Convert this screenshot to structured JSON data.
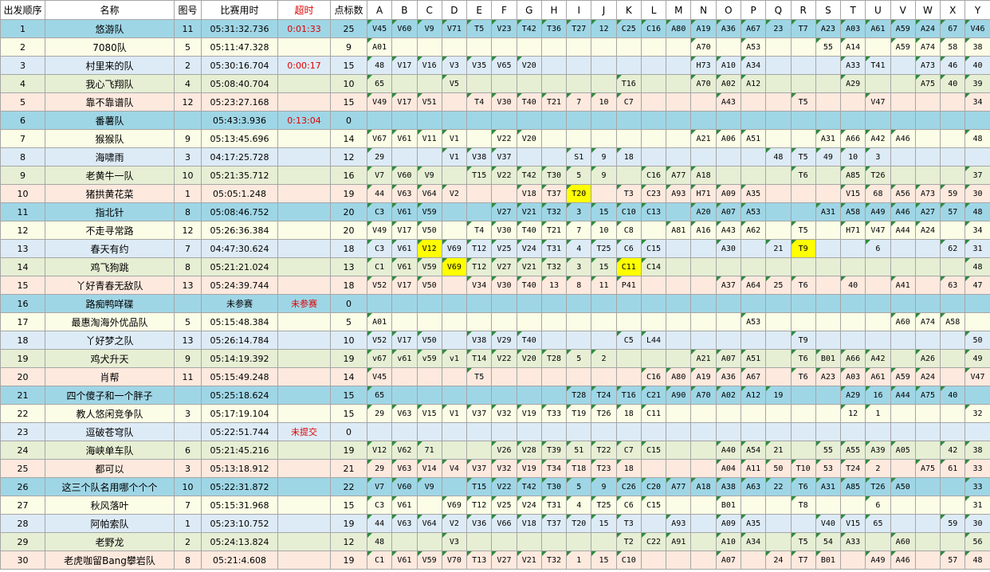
{
  "headers": {
    "order": "出发顺序",
    "name": "名称",
    "map": "图号",
    "time": "比赛用时",
    "overtime": "超时",
    "points": "点标数",
    "cols": [
      "A",
      "B",
      "C",
      "D",
      "E",
      "F",
      "G",
      "H",
      "I",
      "J",
      "K",
      "L",
      "M",
      "N",
      "O",
      "P",
      "Q",
      "R",
      "S",
      "T",
      "U",
      "V",
      "W",
      "X",
      "Y"
    ]
  },
  "palette": [
    "#9fd6e6",
    "#fbfde6",
    "#ddebf6",
    "#e6efd4",
    "#fde9de"
  ],
  "markers": {
    "triangle_color": "#2e8b3e",
    "highlight_color": "#ffff00",
    "overtime_color": "#e00000"
  },
  "rows": [
    {
      "order": "1",
      "name": "悠游队",
      "map": "11",
      "time": "05:31:32.736",
      "overtime": "0:01:33",
      "points": "25",
      "cells": [
        "V45",
        "V60",
        "V9",
        "V71",
        "T5",
        "V23",
        "T42",
        "T36",
        "T27",
        "12",
        "C25",
        "C16",
        "A80",
        "A19",
        "A36",
        "A67",
        "23",
        "T7",
        "A23",
        "A03",
        "A61",
        "A59",
        "A24",
        "67",
        "V46"
      ]
    },
    {
      "order": "2",
      "name": "7080队",
      "map": "5",
      "time": "05:11:47.328",
      "overtime": "",
      "points": "9",
      "cells": [
        "A01",
        "",
        "",
        "",
        "",
        "",
        "",
        "",
        "",
        "",
        "",
        "",
        "",
        "A70",
        "",
        "A53",
        "",
        "",
        "55",
        "A14",
        "",
        "A59",
        "A74",
        "58",
        "38"
      ]
    },
    {
      "order": "3",
      "name": "村里来的队",
      "map": "2",
      "time": "05:30:16.704",
      "overtime": "0:00:17",
      "points": "15",
      "cells": [
        "48",
        "V17",
        "V16",
        "V3",
        "V35",
        "V65",
        "V20",
        "",
        "",
        "",
        "",
        "",
        "",
        "H73",
        "A10",
        "A34",
        "",
        "",
        "",
        "A33",
        "T41",
        "",
        "A73",
        "46",
        "40"
      ]
    },
    {
      "order": "4",
      "name": "我心飞翔队",
      "map": "4",
      "time": "05:08:40.704",
      "overtime": "",
      "points": "10",
      "cells": [
        "65",
        "",
        "",
        "V5",
        "",
        "",
        "",
        "",
        "",
        "",
        "T16",
        "",
        "",
        "A70",
        "A02",
        "A12",
        "",
        "",
        "",
        "A29",
        "",
        "",
        "A75",
        "40",
        "39"
      ]
    },
    {
      "order": "5",
      "name": "靠不靠谱队",
      "map": "12",
      "time": "05:23:27.168",
      "overtime": "",
      "points": "15",
      "cells": [
        "V49",
        "V17",
        "V51",
        "",
        "T4",
        "V30",
        "T40",
        "T21",
        "7",
        "10",
        "C7",
        "",
        "",
        "",
        "A43",
        "",
        "",
        "T5",
        "",
        "",
        "V47",
        "",
        "",
        "",
        "34"
      ]
    },
    {
      "order": "6",
      "name": "番薯队",
      "map": "",
      "time": "05:43:3.936",
      "overtime": "0:13:04",
      "points": "0",
      "cells": [
        "",
        "",
        "",
        "",
        "",
        "",
        "",
        "",
        "",
        "",
        "",
        "",
        "",
        "",
        "",
        "",
        "",
        "",
        "",
        "",
        "",
        "",
        "",
        "",
        ""
      ]
    },
    {
      "order": "7",
      "name": "猴猴队",
      "map": "9",
      "time": "05:13:45.696",
      "overtime": "",
      "points": "14",
      "cells": [
        "V67",
        "V61",
        "V11",
        "V1",
        "",
        "V22",
        "V20",
        "",
        "",
        "",
        "",
        "",
        "",
        "A21",
        "A06",
        "A51",
        "",
        "",
        "A31",
        "A66",
        "A42",
        "A46",
        "",
        "",
        "48"
      ]
    },
    {
      "order": "8",
      "name": "海啸雨",
      "map": "3",
      "time": "04:17:25.728",
      "overtime": "",
      "points": "12",
      "cells": [
        "29",
        "",
        "",
        "V1",
        "V38",
        "V37",
        "",
        "",
        "S1",
        "9",
        "18",
        "",
        "",
        "",
        "",
        "",
        "48",
        "T5",
        "49",
        "10",
        "3",
        "",
        "",
        "",
        ""
      ]
    },
    {
      "order": "9",
      "name": "老黄牛一队",
      "map": "10",
      "time": "05:21:35.712",
      "overtime": "",
      "points": "16",
      "cells": [
        "V7",
        "V60",
        "V9",
        "",
        "T15",
        "V22",
        "T42",
        "T30",
        "5",
        "9",
        "",
        "C16",
        "A77",
        "A18",
        "",
        "",
        "",
        "T6",
        "",
        "A85",
        "T26",
        "",
        "",
        "",
        "37"
      ]
    },
    {
      "order": "10",
      "name": "猪拱黄花菜",
      "map": "1",
      "time": "05:05:1.248",
      "overtime": "",
      "points": "19",
      "cells": [
        "44",
        "V63",
        "V64",
        "V2",
        "",
        "",
        "V18",
        "T37",
        "T20",
        "",
        "T3",
        "C23",
        "A93",
        "H71",
        "A09",
        "A35",
        "",
        "",
        "",
        "V15",
        "68",
        "A56",
        "A73",
        "59",
        "30"
      ]
    },
    {
      "order": "11",
      "name": "指北针",
      "map": "8",
      "time": "05:08:46.752",
      "overtime": "",
      "points": "20",
      "cells": [
        "C3",
        "V61",
        "V59",
        "",
        "",
        "V27",
        "V21",
        "T32",
        "3",
        "15",
        "C10",
        "C13",
        "",
        "A20",
        "A07",
        "A53",
        "",
        "",
        "A31",
        "A58",
        "A49",
        "A46",
        "A27",
        "57",
        "48"
      ]
    },
    {
      "order": "12",
      "name": "不走寻常路",
      "map": "12",
      "time": "05:26:36.384",
      "overtime": "",
      "points": "20",
      "cells": [
        "V49",
        "V17",
        "V50",
        "",
        "T4",
        "V30",
        "T40",
        "T21",
        "7",
        "10",
        "C8",
        "",
        "A81",
        "A16",
        "A43",
        "A62",
        "",
        "T5",
        "",
        "H71",
        "V47",
        "A44",
        "A24",
        "",
        "34"
      ]
    },
    {
      "order": "13",
      "name": "春天有约",
      "map": "7",
      "time": "04:47:30.624",
      "overtime": "",
      "points": "18",
      "cells": [
        "C3",
        "V61",
        "V12",
        "V69",
        "T12",
        "V25",
        "V24",
        "T31",
        "4",
        "T25",
        "C6",
        "C15",
        "",
        "",
        "A30",
        "",
        "21",
        "T9",
        "",
        "",
        "6",
        "",
        "",
        "62",
        "31"
      ]
    },
    {
      "order": "14",
      "name": "鸡飞狗跳",
      "map": "8",
      "time": "05:21:21.024",
      "overtime": "",
      "points": "13",
      "cells": [
        "C1",
        "V61",
        "V59",
        "V69",
        "T12",
        "V27",
        "V21",
        "T32",
        "3",
        "15",
        "C11",
        "C14",
        "",
        "",
        "",
        "",
        "",
        "",
        "",
        "",
        "",
        "",
        "",
        "",
        "48"
      ]
    },
    {
      "order": "15",
      "name": "丫好青春无敌队",
      "map": "13",
      "time": "05:24:39.744",
      "overtime": "",
      "points": "18",
      "cells": [
        "V52",
        "V17",
        "V50",
        "",
        "V34",
        "V30",
        "T40",
        "13",
        "8",
        "11",
        "P41",
        "",
        "",
        "",
        "A37",
        "A64",
        "25",
        "T6",
        "",
        "40",
        "",
        "A41",
        "",
        "63",
        "47"
      ]
    },
    {
      "order": "16",
      "name": "路痴鸭咩碟",
      "map": "",
      "time": "未参赛",
      "overtime": "未参赛",
      "points": "0",
      "cells": [
        "",
        "",
        "",
        "",
        "",
        "",
        "",
        "",
        "",
        "",
        "",
        "",
        "",
        "",
        "",
        "",
        "",
        "",
        "",
        "",
        "",
        "",
        "",
        "",
        ""
      ]
    },
    {
      "order": "17",
      "name": "最惠淘海外优品队",
      "map": "5",
      "time": "05:15:48.384",
      "overtime": "",
      "points": "5",
      "cells": [
        "A01",
        "",
        "",
        "",
        "",
        "",
        "",
        "",
        "",
        "",
        "",
        "",
        "",
        "",
        "",
        "A53",
        "",
        "",
        "",
        "",
        "",
        "A60",
        "A74",
        "A58",
        ""
      ]
    },
    {
      "order": "18",
      "name": "丫好梦之队",
      "map": "13",
      "time": "05:26:14.784",
      "overtime": "",
      "points": "10",
      "cells": [
        "V52",
        "V17",
        "V50",
        "",
        "V38",
        "V29",
        "T40",
        "",
        "",
        "",
        "C5",
        "L44",
        "",
        "",
        "",
        "",
        "",
        "T9",
        "",
        "",
        "",
        "",
        "",
        "",
        "50"
      ]
    },
    {
      "order": "19",
      "name": "鸡犬升天",
      "map": "9",
      "time": "05:14:19.392",
      "overtime": "",
      "points": "19",
      "cells": [
        "v67",
        "v61",
        "v59",
        "v1",
        "T14",
        "V22",
        "V20",
        "T28",
        "5",
        "2",
        "",
        "",
        "",
        "A21",
        "A07",
        "A51",
        "",
        "T6",
        "B01",
        "A66",
        "A42",
        "",
        "A26",
        "",
        "49"
      ]
    },
    {
      "order": "20",
      "name": "肖帮",
      "map": "11",
      "time": "05:15:49.248",
      "overtime": "",
      "points": "14",
      "cells": [
        "V45",
        "",
        "",
        "",
        "T5",
        "",
        "",
        "",
        "",
        "",
        "",
        "C16",
        "A80",
        "A19",
        "A36",
        "A67",
        "",
        "T6",
        "A23",
        "A03",
        "A61",
        "A59",
        "A24",
        "",
        "V47"
      ]
    },
    {
      "order": "21",
      "name": "四个傻子和一个胖子",
      "map": "",
      "time": "05:25:18.624",
      "overtime": "",
      "points": "15",
      "cells": [
        "65",
        "",
        "",
        "",
        "",
        "",
        "",
        "",
        "T28",
        "T24",
        "T16",
        "C21",
        "A90",
        "A70",
        "A02",
        "A12",
        "19",
        "",
        "",
        "A29",
        "16",
        "A44",
        "A75",
        "40",
        ""
      ]
    },
    {
      "order": "22",
      "name": "教人悠闲竞争队",
      "map": "3",
      "time": "05:17:19.104",
      "overtime": "",
      "points": "15",
      "cells": [
        "29",
        "V63",
        "V15",
        "V1",
        "V37",
        "V32",
        "V19",
        "T33",
        "T19",
        "T26",
        "18",
        "C11",
        "",
        "",
        "",
        "",
        "",
        "",
        "",
        "12",
        "1",
        "",
        "",
        "",
        "32"
      ]
    },
    {
      "order": "23",
      "name": "逗破苍穹队",
      "map": "",
      "time": "05:22:51.744",
      "overtime": "未提交",
      "points": "0",
      "cells": [
        "",
        "",
        "",
        "",
        "",
        "",
        "",
        "",
        "",
        "",
        "",
        "",
        "",
        "",
        "",
        "",
        "",
        "",
        "",
        "",
        "",
        "",
        "",
        "",
        ""
      ]
    },
    {
      "order": "24",
      "name": "海峡单车队",
      "map": "6",
      "time": "05:21:45.216",
      "overtime": "",
      "points": "19",
      "cells": [
        "V12",
        "V62",
        "71",
        "",
        "",
        "V26",
        "V28",
        "T39",
        "51",
        "T22",
        "C7",
        "C15",
        "",
        "",
        "A40",
        "A54",
        "21",
        "",
        "55",
        "A55",
        "A39",
        "A05",
        "",
        "42",
        "38"
      ]
    },
    {
      "order": "25",
      "name": "都可以",
      "map": "3",
      "time": "05:13:18.912",
      "overtime": "",
      "points": "21",
      "cells": [
        "29",
        "V63",
        "V14",
        "V4",
        "V37",
        "V32",
        "V19",
        "T34",
        "T18",
        "T23",
        "18",
        "",
        "",
        "",
        "A04",
        "A11",
        "50",
        "T10",
        "53",
        "T24",
        "2",
        "",
        "A75",
        "61",
        "33"
      ]
    },
    {
      "order": "26",
      "name": "这三个队名用哪个个个",
      "map": "10",
      "time": "05:22:31.872",
      "overtime": "",
      "points": "22",
      "cells": [
        "V7",
        "V60",
        "V9",
        "",
        "T15",
        "V22",
        "T42",
        "T30",
        "5",
        "9",
        "C26",
        "C20",
        "A77",
        "A18",
        "A38",
        "A63",
        "22",
        "T6",
        "A31",
        "A85",
        "T26",
        "A50",
        "",
        "",
        "33"
      ]
    },
    {
      "order": "27",
      "name": "秋风落叶",
      "map": "7",
      "time": "05:15:31.968",
      "overtime": "",
      "points": "15",
      "cells": [
        "C3",
        "V61",
        "",
        "V69",
        "T12",
        "V25",
        "V24",
        "T31",
        "4",
        "T25",
        "C6",
        "C15",
        "",
        "",
        "B01",
        "",
        "",
        "T8",
        "",
        "",
        "6",
        "",
        "",
        "",
        "31"
      ]
    },
    {
      "order": "28",
      "name": "阿帕索队",
      "map": "1",
      "time": "05:23:10.752",
      "overtime": "",
      "points": "19",
      "cells": [
        "44",
        "V63",
        "V64",
        "V2",
        "V36",
        "V66",
        "V18",
        "T37",
        "T20",
        "15",
        "T3",
        "",
        "A93",
        "",
        "A09",
        "A35",
        "",
        "",
        "V40",
        "V15",
        "65",
        "",
        "",
        "59",
        "30"
      ]
    },
    {
      "order": "29",
      "name": "老野龙",
      "map": "2",
      "time": "05:24:13.824",
      "overtime": "",
      "points": "12",
      "cells": [
        "48",
        "",
        "",
        "V3",
        "",
        "",
        "",
        "",
        "",
        "",
        "T2",
        "C22",
        "A91",
        "",
        "A10",
        "A34",
        "",
        "T5",
        "54",
        "A33",
        "",
        "A60",
        "",
        "",
        "56"
      ]
    },
    {
      "order": "30",
      "name": "老虎咖留Bang攀岩队",
      "map": "8",
      "time": "05:21:4.608",
      "overtime": "",
      "points": "19",
      "cells": [
        "C1",
        "V61",
        "V59",
        "V70",
        "T13",
        "V27",
        "V21",
        "T32",
        "1",
        "15",
        "C10",
        "",
        "",
        "",
        "A07",
        "",
        "24",
        "T7",
        "B01",
        "",
        "A49",
        "A46",
        "",
        "57",
        "48"
      ]
    }
  ],
  "highlights": [
    {
      "row": 10,
      "col": 8
    },
    {
      "row": 13,
      "col": 2
    },
    {
      "row": 13,
      "col": 17
    },
    {
      "row": 14,
      "col": 3
    },
    {
      "row": 14,
      "col": 10
    }
  ]
}
